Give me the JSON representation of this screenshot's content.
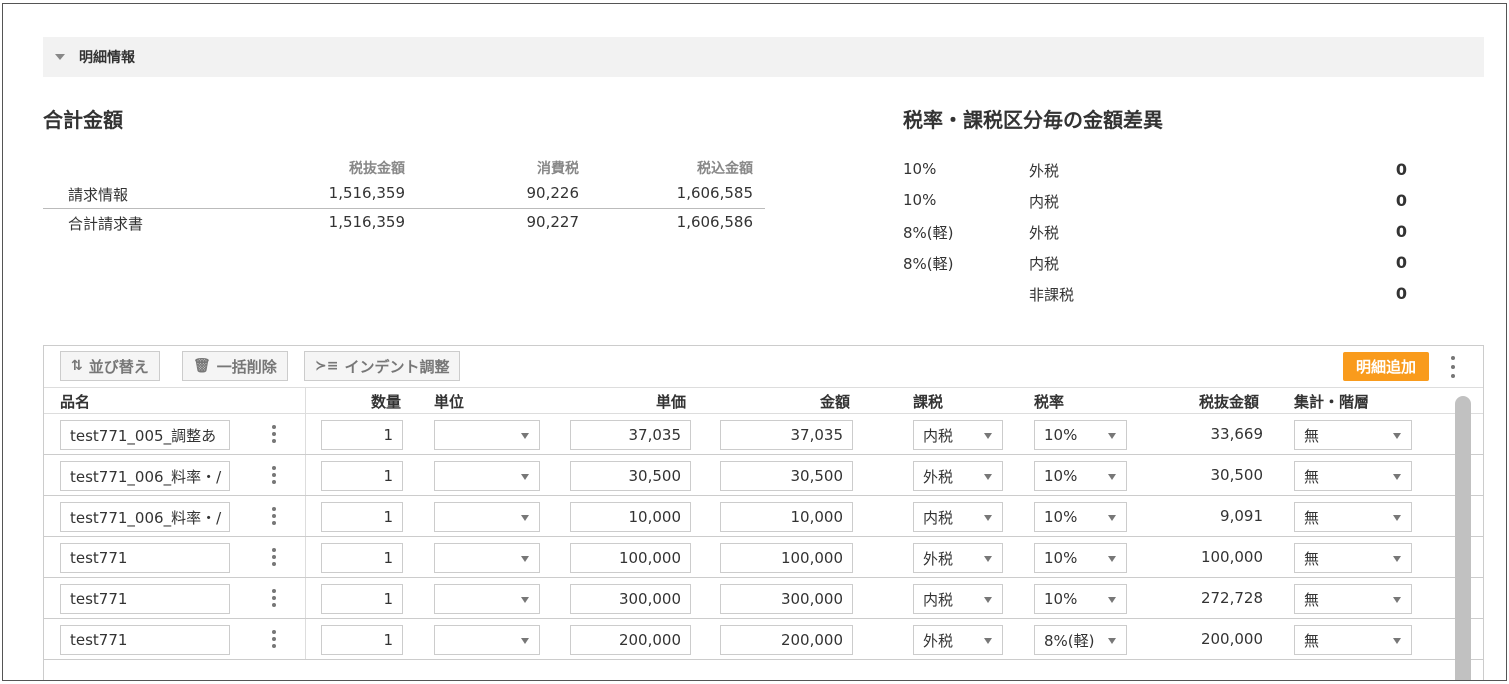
{
  "section": {
    "title": "明細情報"
  },
  "totals": {
    "heading": "合計金額",
    "headers": [
      "税抜金額",
      "消費税",
      "税込金額"
    ],
    "rows": [
      {
        "label": "請求情報",
        "excl": "1,516,359",
        "tax": "90,226",
        "incl": "1,606,585"
      },
      {
        "label": "合計請求書",
        "excl": "1,516,359",
        "tax": "90,227",
        "incl": "1,606,586"
      }
    ]
  },
  "diff": {
    "heading": "税率・課税区分毎の金額差異",
    "rows": [
      {
        "rate": "10%",
        "kind": "外税",
        "value": "0"
      },
      {
        "rate": "10%",
        "kind": "内税",
        "value": "0"
      },
      {
        "rate": "8%(軽)",
        "kind": "外税",
        "value": "0"
      },
      {
        "rate": "8%(軽)",
        "kind": "内税",
        "value": "0"
      },
      {
        "rate": "",
        "kind": "非課税",
        "value": "0"
      }
    ]
  },
  "toolbar": {
    "sort_label": "並び替え",
    "bulk_delete_label": "一括削除",
    "indent_label": "インデント調整",
    "add_label": "明細追加"
  },
  "columns": {
    "name": "品名",
    "qty": "数量",
    "unit": "単位",
    "price": "単価",
    "amount": "金額",
    "tax_type": "課税",
    "tax_rate": "税率",
    "excl": "税抜金額",
    "agg": "集計・階層"
  },
  "rows": [
    {
      "name": "test771_005_調整あ",
      "qty": "1",
      "unit": "",
      "price": "37,035",
      "amount": "37,035",
      "tax_type": "内税",
      "tax_rate": "10%",
      "excl": "33,669",
      "agg": "無"
    },
    {
      "name": "test771_006_料率・/",
      "qty": "1",
      "unit": "",
      "price": "30,500",
      "amount": "30,500",
      "tax_type": "外税",
      "tax_rate": "10%",
      "excl": "30,500",
      "agg": "無"
    },
    {
      "name": "test771_006_料率・/",
      "qty": "1",
      "unit": "",
      "price": "10,000",
      "amount": "10,000",
      "tax_type": "内税",
      "tax_rate": "10%",
      "excl": "9,091",
      "agg": "無"
    },
    {
      "name": "test771",
      "qty": "1",
      "unit": "",
      "price": "100,000",
      "amount": "100,000",
      "tax_type": "外税",
      "tax_rate": "10%",
      "excl": "100,000",
      "agg": "無"
    },
    {
      "name": "test771",
      "qty": "1",
      "unit": "",
      "price": "300,000",
      "amount": "300,000",
      "tax_type": "内税",
      "tax_rate": "10%",
      "excl": "272,728",
      "agg": "無"
    },
    {
      "name": "test771",
      "qty": "1",
      "unit": "",
      "price": "200,000",
      "amount": "200,000",
      "tax_type": "外税",
      "tax_rate": "8%(軽)",
      "excl": "200,000",
      "agg": "無"
    }
  ],
  "colors": {
    "accent": "#f99b1c",
    "header_bg": "#f2f2f2"
  }
}
